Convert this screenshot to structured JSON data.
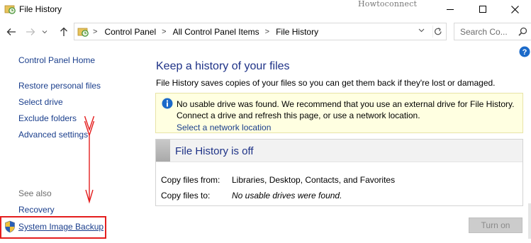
{
  "window": {
    "title": "File History",
    "watermark": "Howtoconnect"
  },
  "address": {
    "breadcrumbs": [
      "Control Panel",
      "All Control Panel Items",
      "File History"
    ],
    "search_placeholder": "Search Co..."
  },
  "sidebar": {
    "home": "Control Panel Home",
    "items": [
      "Restore personal files",
      "Select drive",
      "Exclude folders",
      "Advanced settings"
    ],
    "see_also": "See also",
    "see_also_items": [
      "Recovery",
      "System Image Backup"
    ]
  },
  "main": {
    "heading": "Keep a history of your files",
    "description": "File History saves copies of your files so you can get them back if they're lost or damaged.",
    "info": {
      "line1": "No usable drive was found. We recommend that you use an external drive for File History.",
      "line2": "Connect a drive and refresh this page, or use a network location.",
      "link": "Select a network location"
    },
    "status": {
      "title": "File History is off",
      "rows": [
        {
          "label": "Copy files from:",
          "value": "Libraries, Desktop, Contacts, and Favorites"
        },
        {
          "label": "Copy files to:",
          "value": "No usable drives were found."
        }
      ]
    },
    "turn_on": "Turn on"
  },
  "colors": {
    "link": "#1a3e8c",
    "heading": "#1e3287",
    "info_background": "#ffffe1",
    "highlight_box": "#e41e1e"
  },
  "icons": [
    "file-history-icon",
    "back-arrow-icon",
    "forward-arrow-icon",
    "dropdown-icon",
    "up-arrow-icon",
    "refresh-icon",
    "search-icon",
    "info-icon",
    "shield-icon",
    "help-icon",
    "minimize-icon",
    "maximize-icon",
    "close-icon"
  ]
}
